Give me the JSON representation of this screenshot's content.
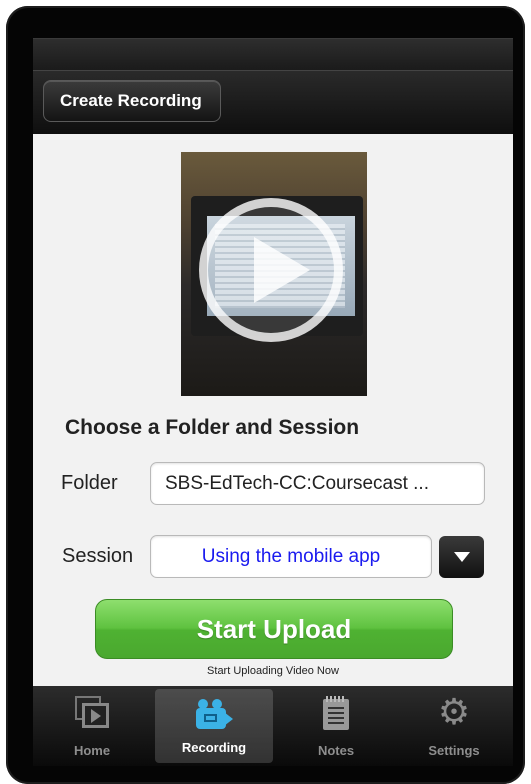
{
  "nav": {
    "back_label": "Create Recording"
  },
  "video": {
    "icon": "play-icon"
  },
  "form": {
    "section_title": "Choose a Folder and Session",
    "folder_label": "Folder",
    "folder_value": "SBS-EdTech-CC:Coursecast ...",
    "session_label": "Session",
    "session_value": "Using the mobile app",
    "dropdown_icon": "triangle-down-icon"
  },
  "upload": {
    "button_label": "Start Upload",
    "caption": "Start Uploading Video Now"
  },
  "tabbar": {
    "items": [
      {
        "label": "Home",
        "icon": "video-library-icon",
        "active": false
      },
      {
        "label": "Recording",
        "icon": "video-camera-icon",
        "active": true
      },
      {
        "label": "Notes",
        "icon": "notepad-icon",
        "active": false
      },
      {
        "label": "Settings",
        "icon": "gear-icon",
        "active": false
      }
    ]
  },
  "colors": {
    "start_button": "#5fc240",
    "session_text": "#1a1aef",
    "recording_icon": "#3bb2e6"
  }
}
